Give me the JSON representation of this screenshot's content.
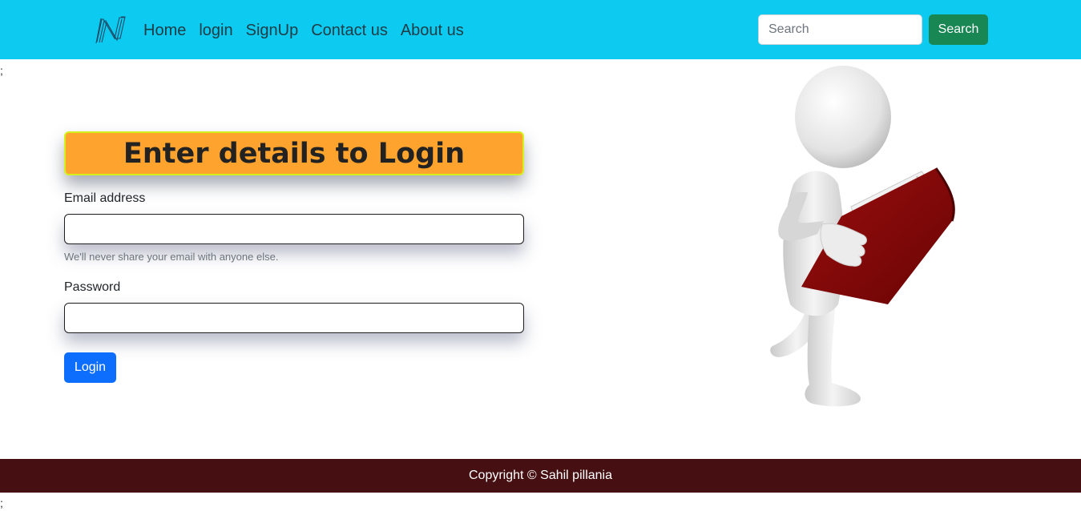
{
  "navbar": {
    "brand_logo": "n-logo-icon",
    "links": [
      "Home",
      "login",
      "SignUp",
      "Contact us",
      "About us"
    ],
    "search": {
      "placeholder": "Search",
      "value": "",
      "button_label": "Search"
    },
    "background_color": "#0dcaf0"
  },
  "stray_text": {
    "top": ";",
    "bottom": ";"
  },
  "login_form": {
    "heading": "Enter details to Login",
    "email_label": "Email address",
    "email_value": "",
    "email_help": "We'll never share your email with anyone else.",
    "password_label": "Password",
    "password_value": "",
    "submit_label": "Login",
    "heading_color": "#fea32e",
    "button_color": "#0d6efd"
  },
  "illustration": {
    "icon": "figure-reading-book-icon"
  },
  "footer": {
    "text": "Copyright © Sahil pillania",
    "background_color": "#461012"
  }
}
